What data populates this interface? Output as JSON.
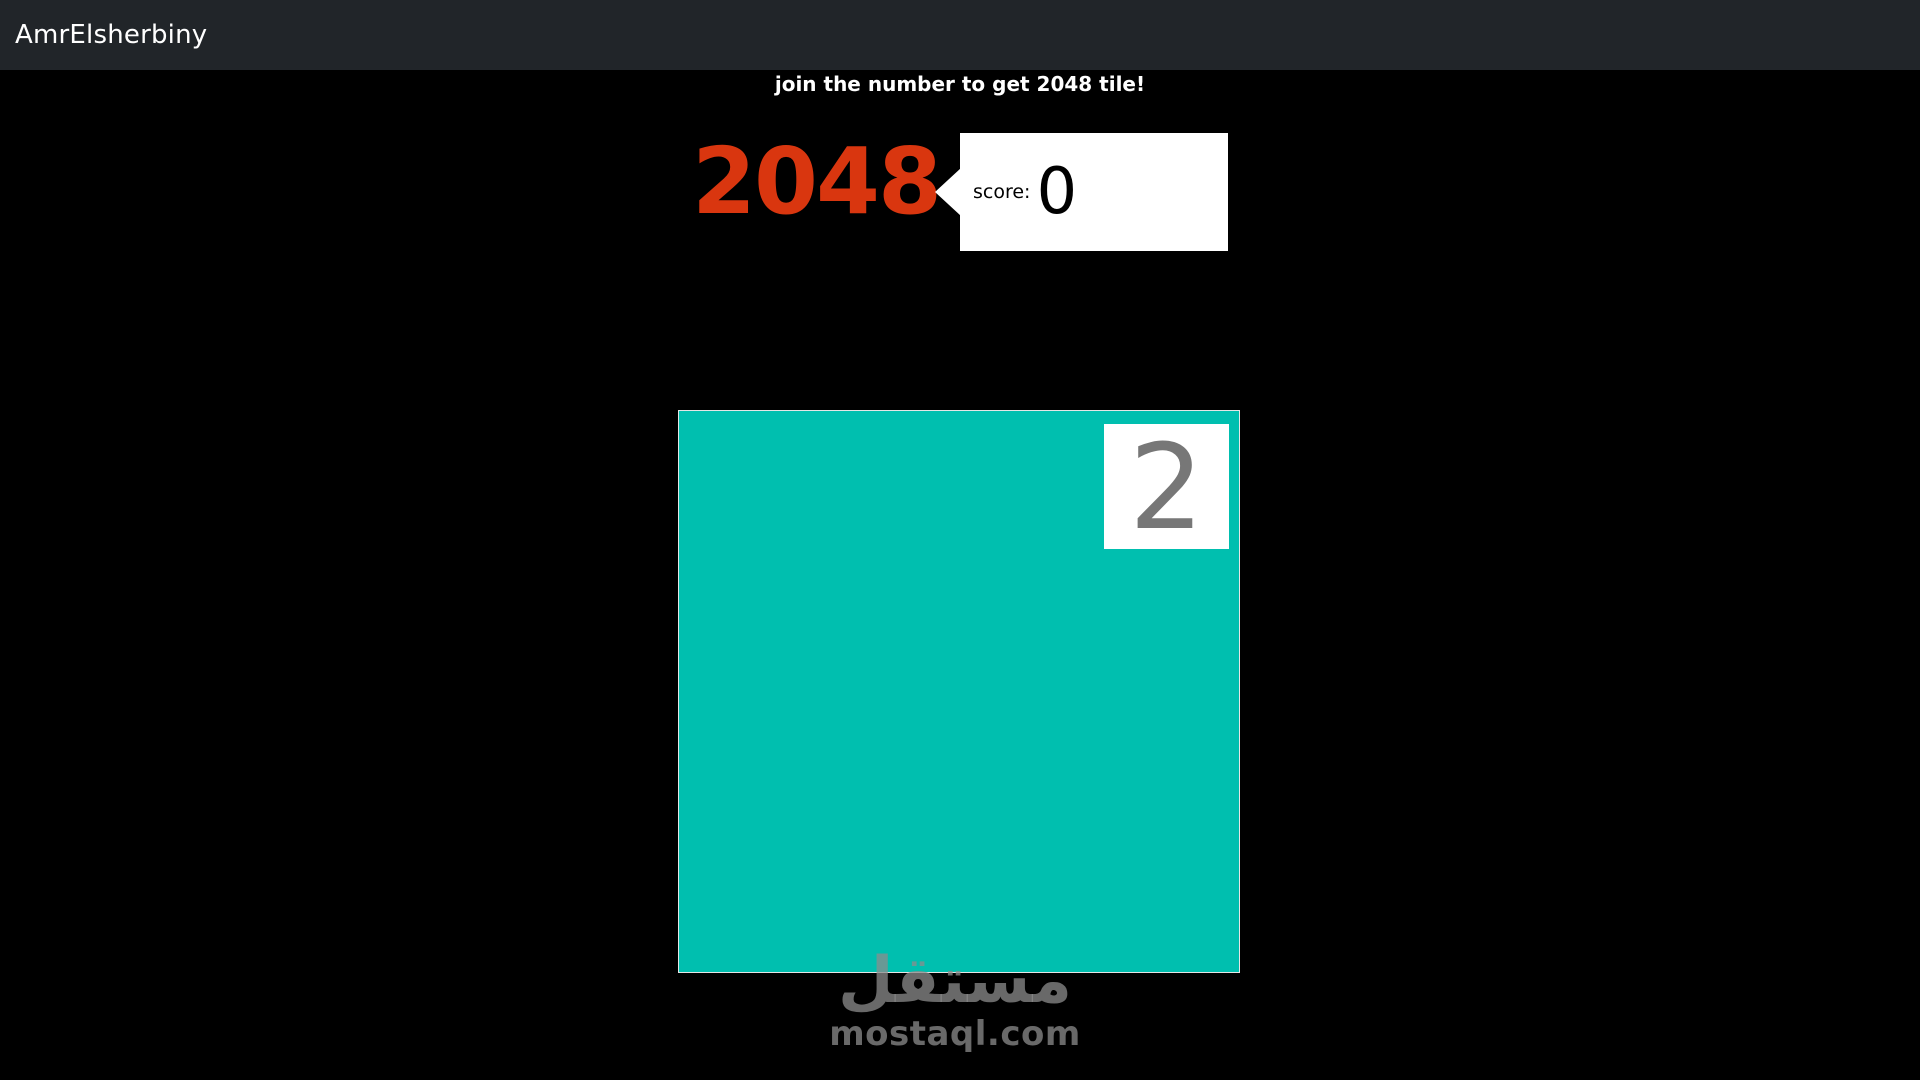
{
  "navbar": {
    "brand": "AmrElsherbiny"
  },
  "header": {
    "subtitle": "join the number to get 2048 tile!",
    "logo": "2048"
  },
  "score": {
    "label": "score:",
    "value": "0"
  },
  "board": {
    "color": "#00bfaf",
    "tiles": [
      {
        "value": "2",
        "row": 0,
        "col": 3
      }
    ]
  },
  "watermark": {
    "arabic": "مستقل",
    "latin": "mostaql.com"
  },
  "colors": {
    "navbar": "#212529",
    "background": "#000000",
    "logo": "#d9360f",
    "tile_text": "#777777"
  }
}
